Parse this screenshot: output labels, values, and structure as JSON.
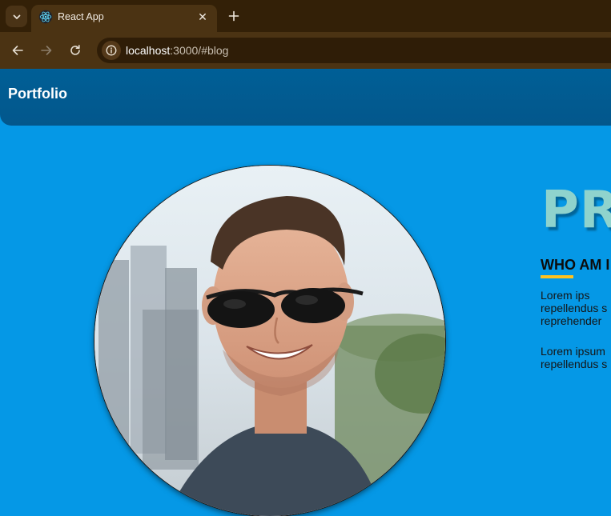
{
  "browser": {
    "tab": {
      "title": "React App"
    },
    "address": {
      "host": "localhost",
      "path": ":3000/#blog"
    }
  },
  "page": {
    "brand": "Portfolio",
    "hero_heading": "PR",
    "about": {
      "title": "WHO AM I",
      "paragraph1": "    Lorem ips\nrepellendus s\nreprehender",
      "paragraph2": "Lorem ipsum\nrepellendus s"
    }
  },
  "colors": {
    "page_background": "#0598e6",
    "navbar": "#005f96",
    "heading": "#8fd3cd",
    "underline_accent": "#ffc21f"
  }
}
